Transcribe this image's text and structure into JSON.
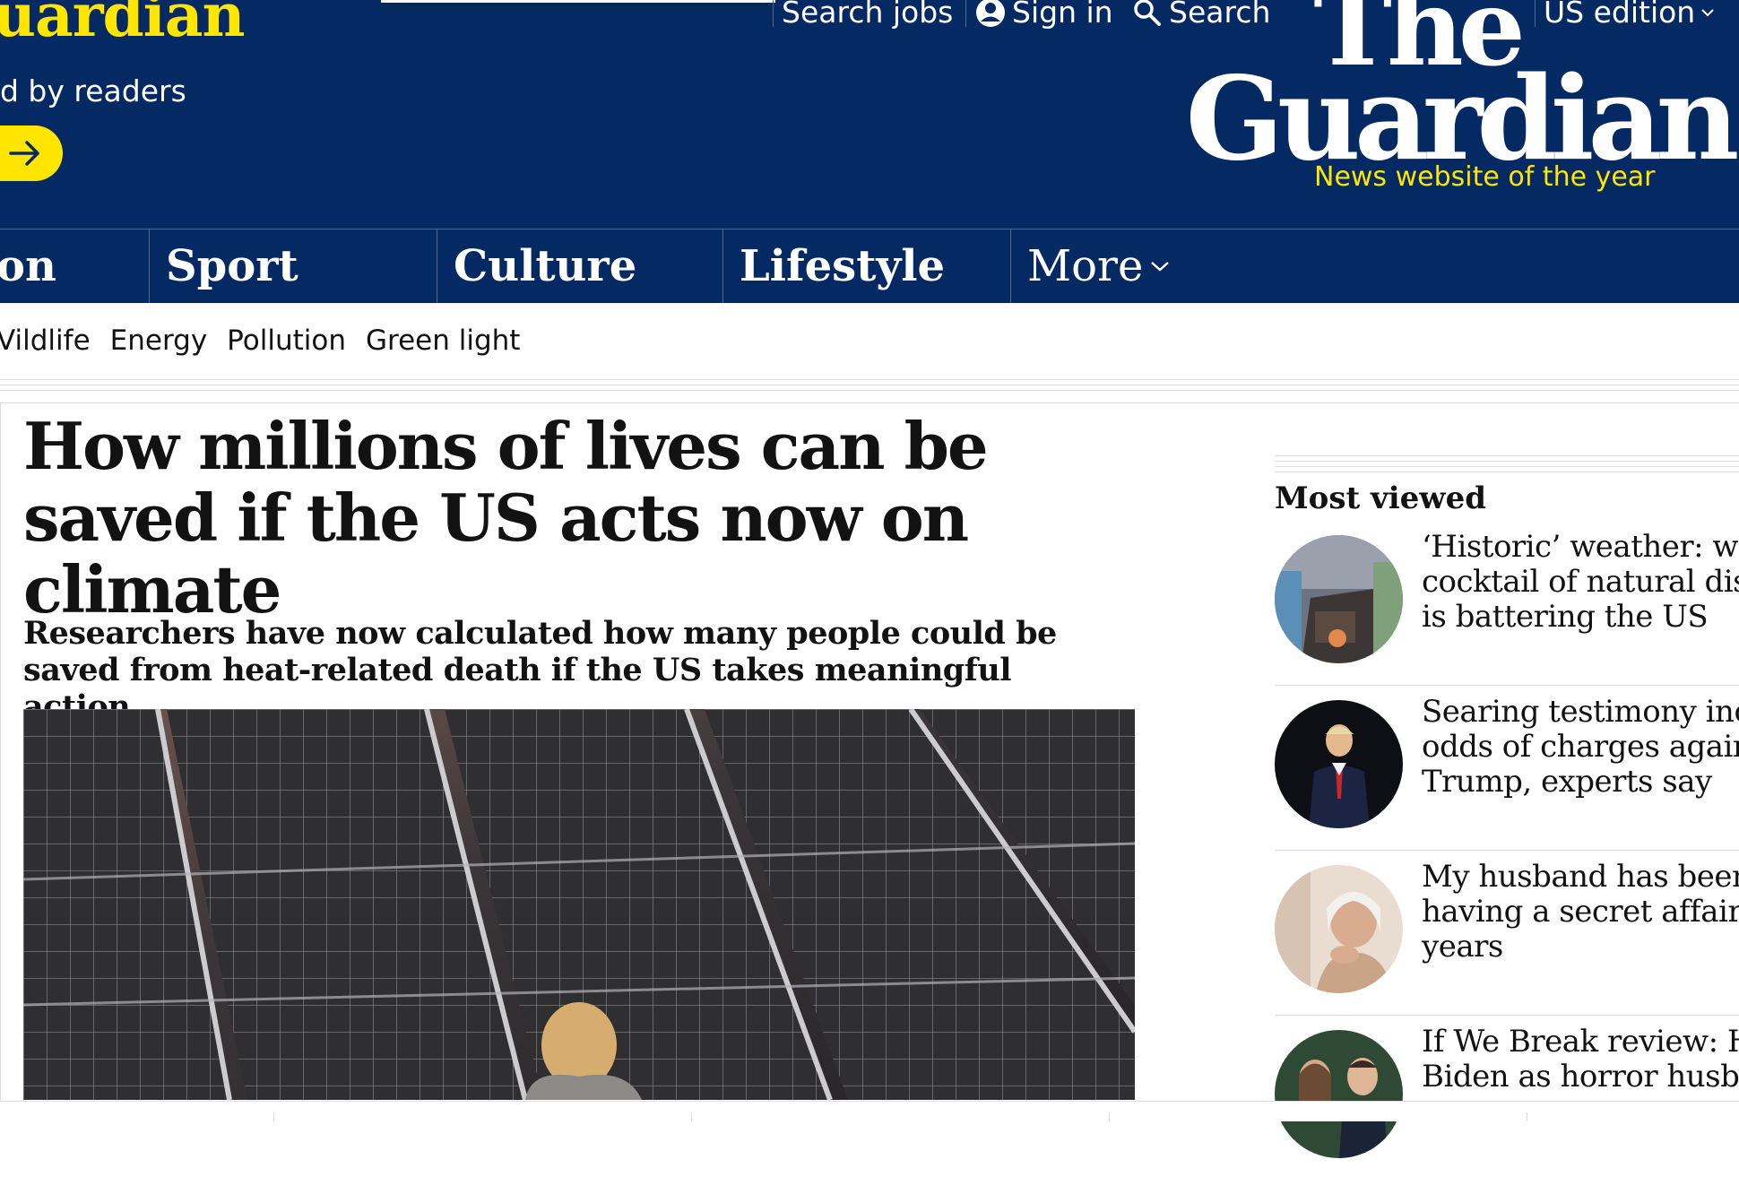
{
  "support": {
    "title": "uardian",
    "subtitle": "d by readers",
    "button_icon": "arrow-right-icon"
  },
  "top_links": {
    "search_jobs": "Search jobs",
    "sign_in": "Sign in",
    "search": "Search",
    "edition": "US edition"
  },
  "logo": {
    "line1": "The",
    "line2": "Guardian",
    "tagline": "News website of the year"
  },
  "pillars": [
    "on",
    "Sport",
    "Culture",
    "Lifestyle",
    "More"
  ],
  "subnav": [
    "Vildlife",
    "Energy",
    "Pollution",
    "Green light"
  ],
  "article": {
    "headline": "How millions of lives can be saved if the US acts now on climate",
    "standfirst": "Researchers have now calculated how many people could be saved from heat-related death if the US takes meaningful action"
  },
  "most_viewed": {
    "heading": "Most viewed",
    "items": [
      {
        "title": "‘Historic’ weather: why\ncocktail of natural disas\nis battering the US"
      },
      {
        "title": "Searing testimony incre\nodds of charges against\nTrump, experts say"
      },
      {
        "title": "My husband has been\nhaving a secret affair fo\nyears"
      },
      {
        "title": "If We Break review: Hun\nBiden as horror husban"
      }
    ]
  },
  "colors": {
    "brand_blue": "#052962",
    "brand_yellow": "#ffe500",
    "text": "#121212",
    "rule": "#dcdcdc"
  }
}
